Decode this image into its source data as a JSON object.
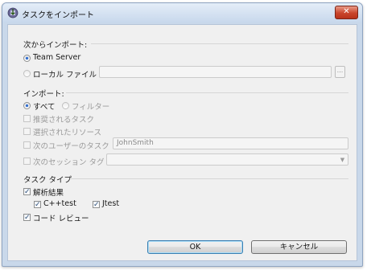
{
  "window": {
    "title": "タスクをインポート",
    "close_glyph": "✕"
  },
  "import_from": {
    "label": "次からインポート:",
    "team_server": "Team Server",
    "local_file": "ローカル ファイル",
    "local_file_value": "",
    "browse_label": "..."
  },
  "import": {
    "label": "インポート:",
    "all": "すべて",
    "filter": "フィルター",
    "recommended": "推奨されるタスク",
    "selected_resources": "選択されたリソース",
    "user_tasks": "次のユーザーのタスク",
    "user_value": "JohnSmith",
    "session_tag": "次のセッション タグ",
    "session_tag_value": ""
  },
  "task_type": {
    "label": "タスク タイプ",
    "analysis_results": "解析結果",
    "cpptest": "C++test",
    "jtest": "Jtest",
    "code_review": "コード レビュー",
    "check_glyph": "✓"
  },
  "buttons": {
    "ok": "OK",
    "cancel": "キャンセル"
  },
  "colors": {
    "accent": "#2c6bd1",
    "close": "#c9452c",
    "frame": "#c9d8ea"
  }
}
